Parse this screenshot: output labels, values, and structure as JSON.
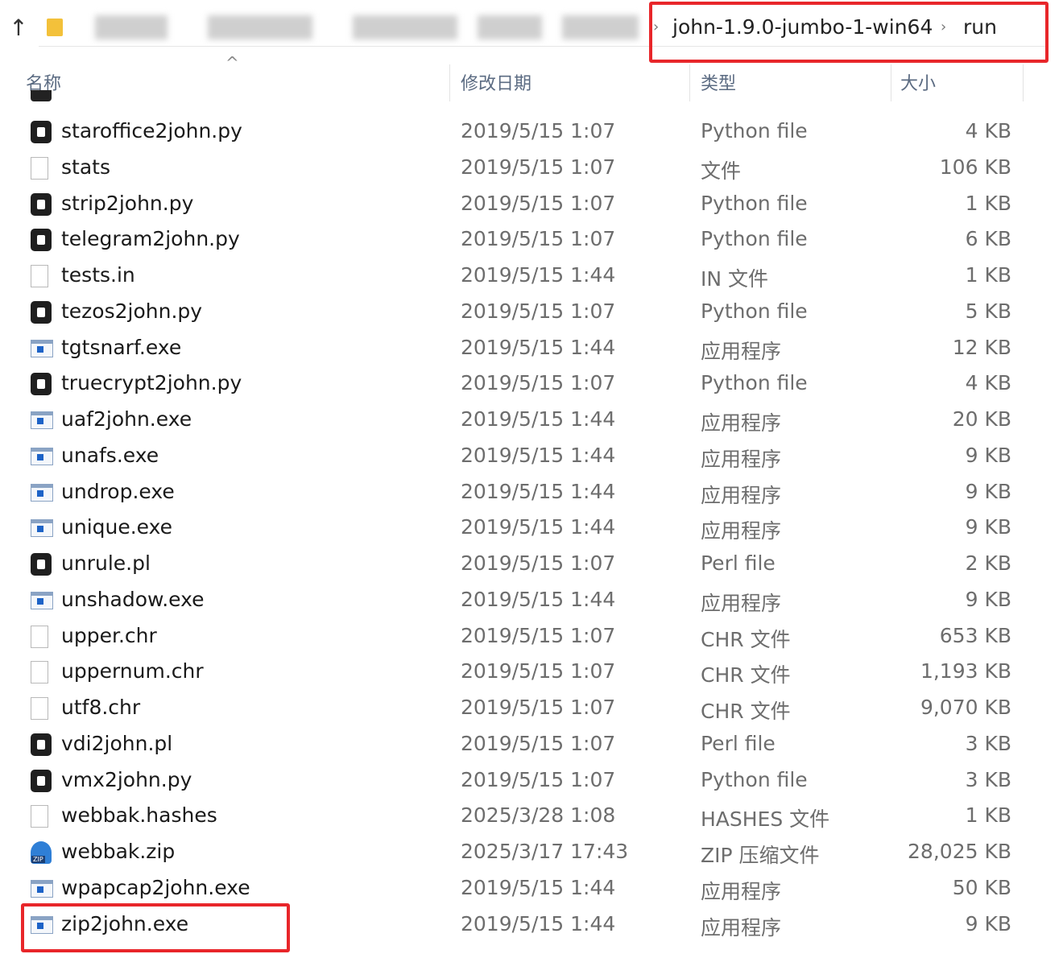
{
  "address": {
    "crumbs": [
      "john-1.9.0-jumbo-1-win64",
      "run"
    ],
    "separator": "›"
  },
  "columns": {
    "name": "名称",
    "date": "修改日期",
    "type": "类型",
    "size": "大小"
  },
  "files": [
    {
      "name": "staroffice2john.py",
      "date": "2019/5/15 1:07",
      "type": "Python file",
      "size": "4 KB",
      "icon": "python-file-icon"
    },
    {
      "name": "stats",
      "date": "2019/5/15 1:07",
      "type": "文件",
      "size": "106 KB",
      "icon": "generic-file-icon"
    },
    {
      "name": "strip2john.py",
      "date": "2019/5/15 1:07",
      "type": "Python file",
      "size": "1 KB",
      "icon": "python-file-icon"
    },
    {
      "name": "telegram2john.py",
      "date": "2019/5/15 1:07",
      "type": "Python file",
      "size": "6 KB",
      "icon": "python-file-icon"
    },
    {
      "name": "tests.in",
      "date": "2019/5/15 1:44",
      "type": "IN 文件",
      "size": "1 KB",
      "icon": "generic-file-icon"
    },
    {
      "name": "tezos2john.py",
      "date": "2019/5/15 1:07",
      "type": "Python file",
      "size": "5 KB",
      "icon": "python-file-icon"
    },
    {
      "name": "tgtsnarf.exe",
      "date": "2019/5/15 1:44",
      "type": "应用程序",
      "size": "12 KB",
      "icon": "exe-file-icon"
    },
    {
      "name": "truecrypt2john.py",
      "date": "2019/5/15 1:07",
      "type": "Python file",
      "size": "4 KB",
      "icon": "python-file-icon"
    },
    {
      "name": "uaf2john.exe",
      "date": "2019/5/15 1:44",
      "type": "应用程序",
      "size": "20 KB",
      "icon": "exe-file-icon"
    },
    {
      "name": "unafs.exe",
      "date": "2019/5/15 1:44",
      "type": "应用程序",
      "size": "9 KB",
      "icon": "exe-file-icon"
    },
    {
      "name": "undrop.exe",
      "date": "2019/5/15 1:44",
      "type": "应用程序",
      "size": "9 KB",
      "icon": "exe-file-icon"
    },
    {
      "name": "unique.exe",
      "date": "2019/5/15 1:44",
      "type": "应用程序",
      "size": "9 KB",
      "icon": "exe-file-icon"
    },
    {
      "name": "unrule.pl",
      "date": "2019/5/15 1:07",
      "type": "Perl file",
      "size": "2 KB",
      "icon": "python-file-icon"
    },
    {
      "name": "unshadow.exe",
      "date": "2019/5/15 1:44",
      "type": "应用程序",
      "size": "9 KB",
      "icon": "exe-file-icon"
    },
    {
      "name": "upper.chr",
      "date": "2019/5/15 1:07",
      "type": "CHR 文件",
      "size": "653 KB",
      "icon": "generic-file-icon"
    },
    {
      "name": "uppernum.chr",
      "date": "2019/5/15 1:07",
      "type": "CHR 文件",
      "size": "1,193 KB",
      "icon": "generic-file-icon"
    },
    {
      "name": "utf8.chr",
      "date": "2019/5/15 1:07",
      "type": "CHR 文件",
      "size": "9,070 KB",
      "icon": "generic-file-icon"
    },
    {
      "name": "vdi2john.pl",
      "date": "2019/5/15 1:07",
      "type": "Perl file",
      "size": "3 KB",
      "icon": "python-file-icon"
    },
    {
      "name": "vmx2john.py",
      "date": "2019/5/15 1:07",
      "type": "Python file",
      "size": "3 KB",
      "icon": "python-file-icon"
    },
    {
      "name": "webbak.hashes",
      "date": "2025/3/28 1:08",
      "type": "HASHES 文件",
      "size": "1 KB",
      "icon": "generic-file-icon"
    },
    {
      "name": "webbak.zip",
      "date": "2025/3/17 17:43",
      "type": "ZIP 压缩文件",
      "size": "28,025 KB",
      "icon": "zip-file-icon"
    },
    {
      "name": "wpapcap2john.exe",
      "date": "2019/5/15 1:44",
      "type": "应用程序",
      "size": "50 KB",
      "icon": "exe-file-icon"
    },
    {
      "name": "zip2john.exe",
      "date": "2019/5/15 1:44",
      "type": "应用程序",
      "size": "9 KB",
      "icon": "exe-file-icon"
    }
  ],
  "highlight_color": "#e8262a"
}
